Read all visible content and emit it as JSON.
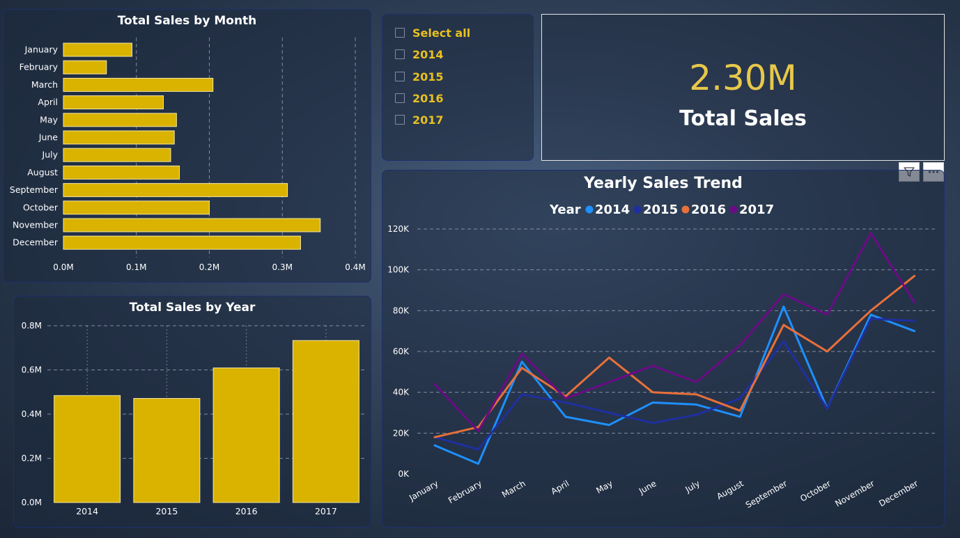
{
  "colors": {
    "bar": "#d9b300",
    "bar_stroke": "#f4e7a6",
    "series": [
      "#1e90ff",
      "#1f2fa0",
      "#e8703a",
      "#6a0c86"
    ],
    "grid": "#aab4c4"
  },
  "month_chart": {
    "title": "Total Sales by Month",
    "chart_data": {
      "type": "bar",
      "orientation": "horizontal",
      "categories": [
        "January",
        "February",
        "March",
        "April",
        "May",
        "June",
        "July",
        "August",
        "September",
        "October",
        "November",
        "December"
      ],
      "values": [
        0.094,
        0.059,
        0.205,
        0.137,
        0.155,
        0.152,
        0.147,
        0.159,
        0.307,
        0.2,
        0.352,
        0.325
      ],
      "xlim": [
        0,
        0.4
      ],
      "ticks": [
        "0.0M",
        "0.1M",
        "0.2M",
        "0.3M",
        "0.4M"
      ],
      "grid": true
    }
  },
  "year_chart": {
    "title": "Total Sales by Year",
    "chart_data": {
      "type": "bar",
      "categories": [
        "2014",
        "2015",
        "2016",
        "2017"
      ],
      "values": [
        0.484,
        0.471,
        0.609,
        0.733
      ],
      "ylim": [
        0,
        0.8
      ],
      "ticks": [
        "0.0M",
        "0.2M",
        "0.4M",
        "0.6M",
        "0.8M"
      ],
      "grid": true
    }
  },
  "slicer": {
    "items": [
      "Select all",
      "2014",
      "2015",
      "2016",
      "2017"
    ]
  },
  "kpi": {
    "value": "2.30M",
    "label": "Total Sales"
  },
  "trend_chart": {
    "title": "Yearly Sales Trend",
    "legend_title": "Year",
    "chart_data": {
      "type": "line",
      "categories": [
        "January",
        "February",
        "March",
        "April",
        "May",
        "June",
        "July",
        "August",
        "September",
        "October",
        "November",
        "December"
      ],
      "series": [
        {
          "name": "2014",
          "values": [
            14,
            5,
            55,
            28,
            24,
            35,
            34,
            28,
            82,
            32,
            78,
            70
          ]
        },
        {
          "name": "2015",
          "values": [
            18,
            12,
            39,
            35,
            30,
            25,
            29,
            37,
            65,
            32,
            76,
            75
          ]
        },
        {
          "name": "2016",
          "values": [
            18,
            23,
            52,
            38,
            57,
            40,
            39,
            31,
            73,
            60,
            80,
            97
          ]
        },
        {
          "name": "2017",
          "values": [
            44,
            21,
            59,
            37,
            45,
            53,
            45,
            63,
            88,
            78,
            118,
            84
          ]
        }
      ],
      "ylim": [
        0,
        120
      ],
      "ticks": [
        "0K",
        "20K",
        "40K",
        "60K",
        "80K",
        "100K",
        "120K"
      ],
      "legend": "top",
      "grid": true
    }
  },
  "visual_header": {
    "filter_icon": "filter-icon",
    "more_icon": "more-options-icon"
  }
}
